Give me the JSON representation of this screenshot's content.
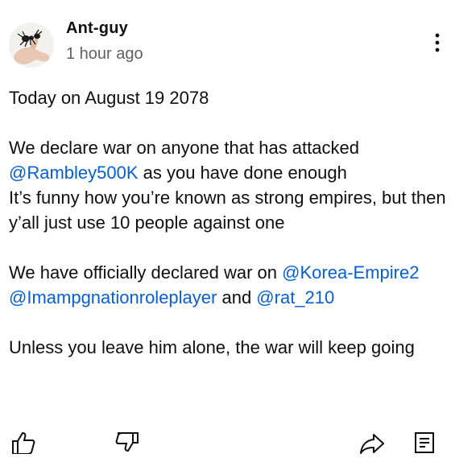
{
  "post": {
    "author": "Ant-guy",
    "time": "1 hour ago",
    "body": {
      "line1": "Today on August 19 2078",
      "p2_a": "We declare war on anyone that has attacked",
      "p2_mention": "@Rambley500K",
      "p2_b": " as you have done enough",
      "p2_c": "It’s funny how you’re known as strong empires, but then y’all just use 10 people against one",
      "p3_a": "We have officially declared war on ",
      "p3_mention1": "@Korea-Empire2",
      "p3_mention2": "@Imampgnationroleplayer",
      "p3_and": " and ",
      "p3_mention3": "@rat_210",
      "p4": "Unless you leave him alone, the war will keep going"
    }
  },
  "icons": {
    "avatar": "ant-on-hand-avatar",
    "more": "more-vertical-icon",
    "like": "thumbs-up-icon",
    "dislike": "thumbs-down-icon",
    "share": "share-icon",
    "comments": "comments-icon"
  },
  "colors": {
    "text": "#0f0f0f",
    "secondary": "#606060",
    "link": "#065fd4"
  }
}
